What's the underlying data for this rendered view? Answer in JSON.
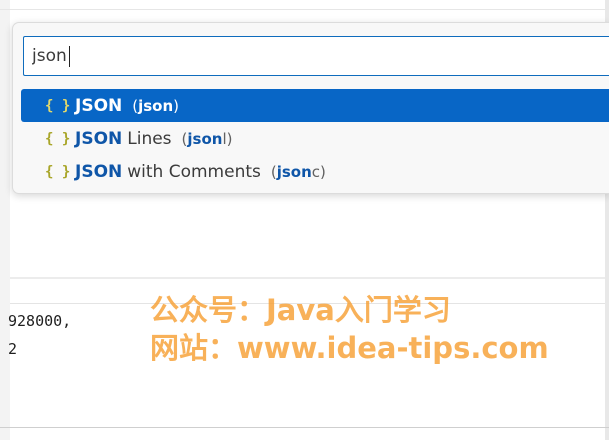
{
  "quick_pick": {
    "search_value": "json",
    "items": [
      {
        "icon": "{ }",
        "match": "JSON",
        "rest": "",
        "lang_match": "json",
        "lang_rest": "",
        "selected": true
      },
      {
        "icon": "{ }",
        "match": "JSON",
        "rest": "Lines",
        "lang_match": "json",
        "lang_rest": "l",
        "selected": false
      },
      {
        "icon": "{ }",
        "match": "JSON",
        "rest": "with Comments",
        "lang_match": "json",
        "lang_rest": "c",
        "selected": false
      }
    ]
  },
  "editor": {
    "lines": [
      "928000,",
      "2"
    ]
  },
  "watermark": {
    "line1": "公众号：Java入门学习",
    "line2": "网站：www.idea-tips.com"
  },
  "icons": {
    "language_item": "braces-icon"
  },
  "colors": {
    "accent": "#0866c6",
    "match": "#0f56a8",
    "brace": "#a9a62a",
    "watermark": "#f6a034"
  }
}
